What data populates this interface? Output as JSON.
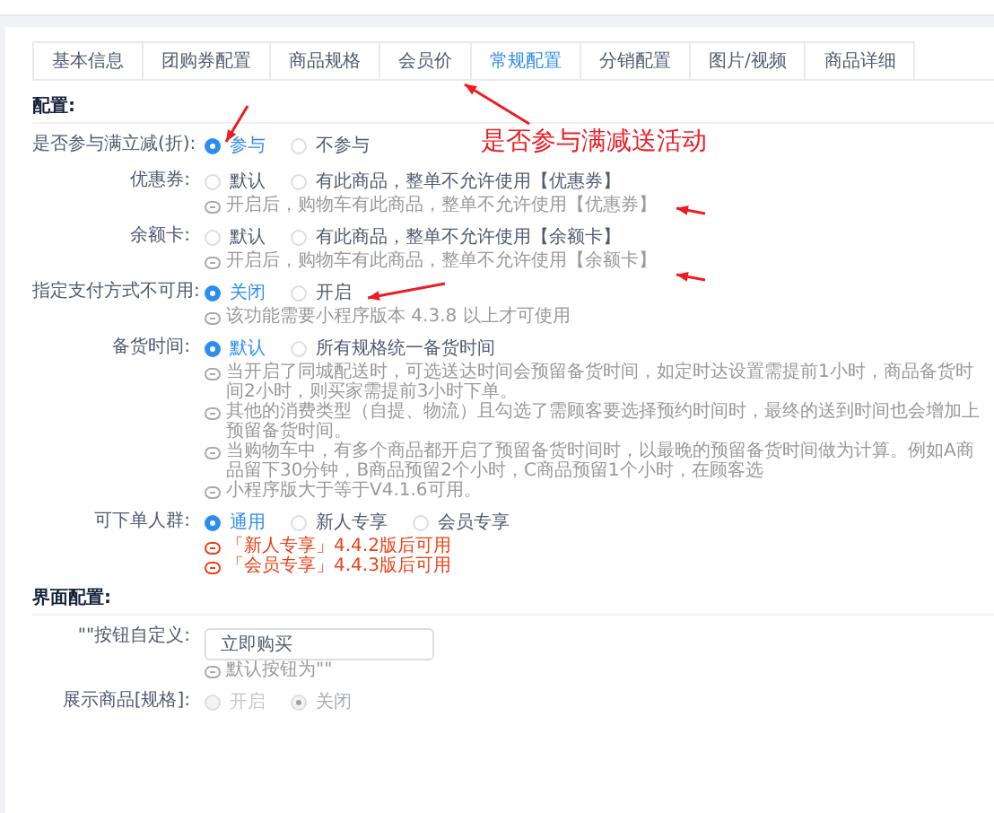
{
  "tabs": [
    {
      "label": "基本信息",
      "selected": false
    },
    {
      "label": "团购券配置",
      "selected": false
    },
    {
      "label": "商品规格",
      "selected": false
    },
    {
      "label": "会员价",
      "selected": false
    },
    {
      "label": "常规配置",
      "selected": true
    },
    {
      "label": "分销配置",
      "selected": false
    },
    {
      "label": "图片/视频",
      "selected": false
    },
    {
      "label": "商品详细",
      "selected": false
    }
  ],
  "sections": [
    {
      "title": "配置:",
      "rows": [
        {
          "kind": "radio",
          "label": "是否参与满立减(折):",
          "options": [
            {
              "label": "参与",
              "selected": true
            },
            {
              "label": "不参与",
              "selected": false
            }
          ],
          "annotation": "是否参与满减送活动"
        },
        {
          "kind": "radio",
          "label": "优惠券:",
          "options": [
            {
              "label": "默认",
              "selected": false
            },
            {
              "label": "有此商品，整单不允许使用【优惠券】",
              "selected": false
            }
          ],
          "hints": [
            {
              "text": "开启后，购物车有此商品，整单不允许使用【优惠券】",
              "warn": false
            }
          ]
        },
        {
          "kind": "radio",
          "label": "余额卡:",
          "options": [
            {
              "label": "默认",
              "selected": false
            },
            {
              "label": "有此商品，整单不允许使用【余额卡】",
              "selected": false
            }
          ],
          "hints": [
            {
              "text": "开启后，购物车有此商品，整单不允许使用【余额卡】",
              "warn": false
            }
          ]
        },
        {
          "kind": "radio",
          "label": "指定支付方式不可用:",
          "options": [
            {
              "label": "关闭",
              "selected": true
            },
            {
              "label": "开启",
              "selected": false
            }
          ],
          "hints": [
            {
              "text": "该功能需要小程序版本 4.3.8 以上才可使用",
              "warn": false
            }
          ]
        },
        {
          "kind": "radio",
          "label": "备货时间:",
          "options": [
            {
              "label": "默认",
              "selected": true
            },
            {
              "label": "所有规格统一备货时间",
              "selected": false
            }
          ],
          "hints": [
            {
              "text": "当开启了同城配送时，可选送达时间会预留备货时间，如定时达设置需提前1小时，商品备货时间2小时，则买家需提前3小时下单。",
              "warn": false
            },
            {
              "text": "其他的消费类型（自提、物流）且勾选了需顾客要选择预约时间时，最终的送到时间也会增加上预留备货时间。",
              "warn": false
            },
            {
              "text": "当购物车中，有多个商品都开启了预留备货时间时，以最晚的预留备货时间做为计算。例如A商品留下30分钟，B商品预留2个小时，C商品预留1个小时，在顾客选",
              "warn": false
            },
            {
              "text": "小程序版大于等于V4.1.6可用。",
              "warn": false
            }
          ]
        },
        {
          "kind": "radio",
          "label": "可下单人群:",
          "options": [
            {
              "label": "通用",
              "selected": true
            },
            {
              "label": "新人专享",
              "selected": false
            },
            {
              "label": "会员专享",
              "selected": false
            }
          ],
          "hints": [
            {
              "text": "「新人专享」4.4.2版后可用",
              "warn": true
            },
            {
              "text": "「会员专享」4.4.3版后可用",
              "warn": true
            }
          ]
        }
      ]
    },
    {
      "title": "界面配置:",
      "rows": [
        {
          "kind": "input",
          "label": "\"\"按钮自定义:",
          "value": "立即购买",
          "hints": [
            {
              "text": "默认按钮为\"\"",
              "warn": false
            }
          ]
        },
        {
          "kind": "radio",
          "label": "展示商品[规格]:",
          "disabled": true,
          "options": [
            {
              "label": "开启",
              "selected": false
            },
            {
              "label": "关闭",
              "selected": true
            }
          ]
        }
      ]
    }
  ]
}
